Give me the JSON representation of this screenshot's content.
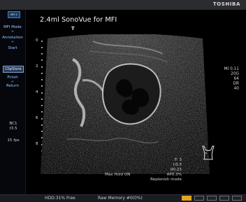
{
  "header": {
    "brand": "TOSHIBA"
  },
  "left_panel": {
    "mode_chip": "MFI 1",
    "menu_top": [
      {
        "label": "MFI Mode"
      },
      {
        "label": "Annotation"
      },
      {
        "label": "Start"
      }
    ],
    "clipstore_label": "ClipStore",
    "menu_bottom": [
      {
        "label": "Finish"
      },
      {
        "label": "Return"
      }
    ],
    "arrow_glyph": "≈",
    "preset_lines": [
      "BC1",
      "t3.5"
    ],
    "fps": "15 fps"
  },
  "image": {
    "title": "2.4ml SonoVue for MFI",
    "marker": "T",
    "depth_ticks": [
      "0",
      "2",
      "4",
      "6",
      "8"
    ]
  },
  "right_info": {
    "lines": [
      "MI 0.11",
      "20G",
      "64",
      "DR",
      "40"
    ]
  },
  "bottom_info": {
    "right_lines": [
      "F: 3",
      "I:0.3",
      "00:23",
      "AP0.3%"
    ],
    "max_hold": "Max Hold ON",
    "replenish": "Replenish mode"
  },
  "status": {
    "hdd": "HDD:31% Free",
    "raw": "Raw Memory #0(0%)"
  },
  "colors": {
    "accent": "#e0a51d",
    "menu_text": "#9ec8ff",
    "panel_bg": "#05070c"
  }
}
